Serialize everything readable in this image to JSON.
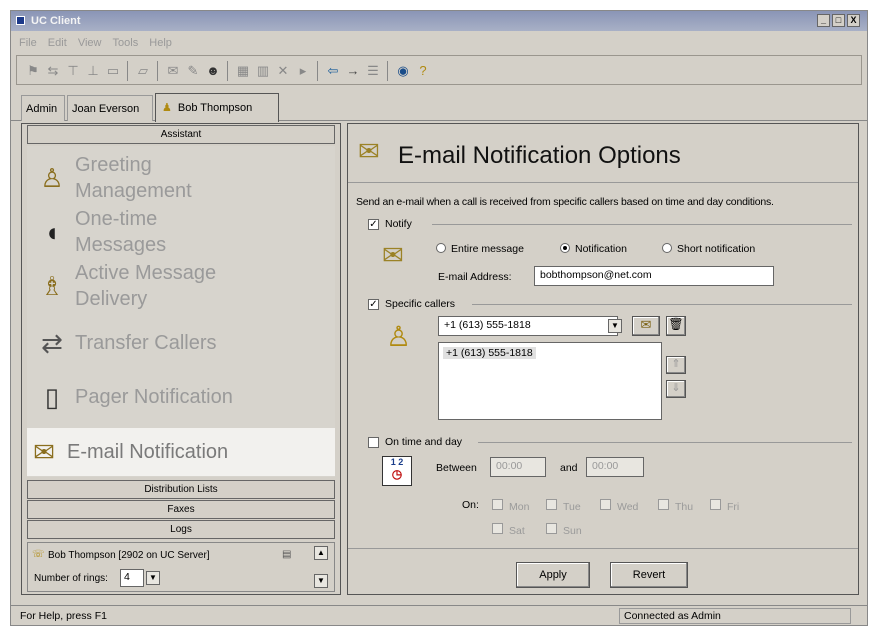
{
  "window": {
    "title": "UC Client",
    "min_label": "_",
    "max_label": "□",
    "close_label": "X"
  },
  "menu": [
    "File",
    "Edit",
    "View",
    "Tools",
    "Help"
  ],
  "toolbar": {
    "icons": [
      "new-user-icon",
      "split-icon",
      "tree-icon",
      "tree2-icon",
      "folder-icon",
      "open-folder-icon",
      "mail-icon",
      "edit-icon",
      "people-icon",
      "grid-icon",
      "grid2-icon",
      "delete-icon",
      "play-icon",
      "back-icon",
      "forward-icon",
      "list-icon",
      "globe-icon",
      "help-icon"
    ]
  },
  "user_tabs": [
    "Admin",
    "Joan Everson",
    "Bob Thompson"
  ],
  "left": {
    "assistant_label": "Assistant",
    "nav": [
      {
        "label": "Greeting\nManagement",
        "icon": "greeting-icon"
      },
      {
        "label": "One-time\nMessages",
        "icon": "one-time-icon"
      },
      {
        "label": "Active Message\nDelivery",
        "icon": "delivery-icon"
      },
      {
        "label": "Transfer Callers",
        "icon": "transfer-icon"
      },
      {
        "label": "Pager Notification",
        "icon": "pager-icon"
      },
      {
        "label": "E-mail Notification",
        "icon": "email-icon"
      }
    ],
    "sections": [
      "Distribution Lists",
      "Faxes",
      "Logs"
    ],
    "status": {
      "user": "Bob Thompson [2902 on UC Server]",
      "rings_label": "Number of rings:",
      "rings_value": "4"
    }
  },
  "right": {
    "title": "E-mail Notification Options",
    "description": "Send an e-mail when a call is received from specific callers based on time and day conditions.",
    "notify": {
      "label": "Notify",
      "checked": true,
      "options": [
        "Entire message",
        "Notification",
        "Short notification"
      ],
      "selected": "Notification",
      "email_label": "E-mail Address:",
      "email_value": "bobthompson@net.com"
    },
    "callers": {
      "label": "Specific callers",
      "checked": true,
      "selected": "+1 (613) 555-1818",
      "list": [
        "+1 (613) 555-1818"
      ]
    },
    "time": {
      "label": "On time and day",
      "checked": false,
      "between_label": "Between",
      "from": "00:00",
      "and_label": "and",
      "to": "00:00",
      "on_label": "On:",
      "days": [
        "Mon",
        "Tue",
        "Wed",
        "Thu",
        "Fri",
        "Sat",
        "Sun"
      ]
    },
    "apply_label": "Apply",
    "revert_label": "Revert"
  },
  "statusbar": {
    "help": "For Help, press F1",
    "connection": "Connected as Admin"
  }
}
